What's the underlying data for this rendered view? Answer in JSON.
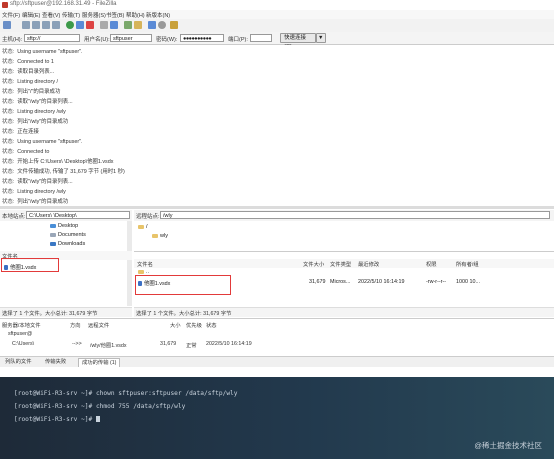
{
  "titlebar": {
    "title": "sftp://sftpuser@192.168.31.49 - FileZilla"
  },
  "menu": [
    "文件(F)",
    "编辑(E)",
    "查看(V)",
    "传输(T)",
    "服务器(S)",
    "书签(B)",
    "帮助(H)",
    "新版本(N)"
  ],
  "quickconnect": {
    "host_label": "主机(H):",
    "host_value": "sftp://",
    "user_label": "用户名(U):",
    "user_value": "sftpuser",
    "pass_label": "密码(W):",
    "pass_value": "●●●●●●●●●●",
    "port_label": "端口(P):",
    "port_value": "",
    "button": "快速连接(Q)",
    "dropdown": "▼"
  },
  "log": [
    {
      "label": "状态:",
      "text": "Using username \"sftpuser\"."
    },
    {
      "label": "状态:",
      "text": "Connected to 1"
    },
    {
      "label": "状态:",
      "text": "读取目录列表..."
    },
    {
      "label": "状态:",
      "text": "Listing directory /"
    },
    {
      "label": "状态:",
      "text": "列出\"/\"的目录成功"
    },
    {
      "label": "状态:",
      "text": "读取\"/wly\"的目录列表..."
    },
    {
      "label": "状态:",
      "text": "Listing directory /wly"
    },
    {
      "label": "状态:",
      "text": "列出\"/wly\"的目录成功"
    },
    {
      "label": "状态:",
      "text": "正在连接"
    },
    {
      "label": "状态:",
      "text": "Using username \"sftpuser\"."
    },
    {
      "label": "状态:",
      "text": "Connected to"
    },
    {
      "label": "状态:",
      "text": "开始上传 C:\\Users\\          \\Desktop\\他圈1.vsdx"
    },
    {
      "label": "状态:",
      "text": "文件传输成功, 传输了 31,679 字节 (用时1 秒)"
    },
    {
      "label": "状态:",
      "text": "读取\"/wly\"的目录列表..."
    },
    {
      "label": "状态:",
      "text": "Listing directory /wly"
    },
    {
      "label": "状态:",
      "text": "列出\"/wly\"的目录成功"
    }
  ],
  "local": {
    "path_label": "本地站点:",
    "path_value": "C:\\Users\\          \\Desktop\\",
    "tree": [
      "Desktop",
      "Documents",
      "Downloads"
    ],
    "list_header": "文件名",
    "files": [
      {
        "name": "他圈1.vsdx"
      }
    ],
    "status": "选择了 1 个文件。大小总计: 31,679 字节"
  },
  "remote": {
    "path_label": "远程站点:",
    "path_value": "/wly",
    "tree": [
      "/",
      "wly"
    ],
    "headers": [
      "文件名",
      "文件大小",
      "文件类型",
      "最近修改",
      "权限",
      "所有者/组"
    ],
    "files": [
      {
        "name": "他圈1.vsdx",
        "size": "31,679",
        "type": "Micros...",
        "modified": "2022/5/10 16:14:19",
        "perms": "-rw-r--r--",
        "owner": "1000 10..."
      }
    ],
    "parent": "..",
    "status": "选择了 1 个文件。大小总计: 31,679 字节"
  },
  "queue": {
    "headers": [
      "服务器/本地文件",
      "方向",
      "远程文件",
      "大小",
      "优先级",
      "状态"
    ],
    "server": "sftpuser@",
    "row": {
      "local": "C:\\Users\\",
      "dir": "-->>",
      "remote": "/wly/他圈1.vsdx",
      "size": "31,679",
      "priority": "正常",
      "time": "2022/5/10 16:14:19"
    }
  },
  "tabs": [
    "列队的文件",
    "传输失败",
    "成功的传输 (1)"
  ],
  "terminal": [
    "[root@WiFi-R3-srv ~]# chown sftpuser:sftpuser /data/sftp/wly",
    "[root@WiFi-R3-srv ~]# chmod 755 /data/sftp/wly",
    "[root@WiFi-R3-srv ~]# "
  ],
  "watermark": "@稀土掘金技术社区"
}
